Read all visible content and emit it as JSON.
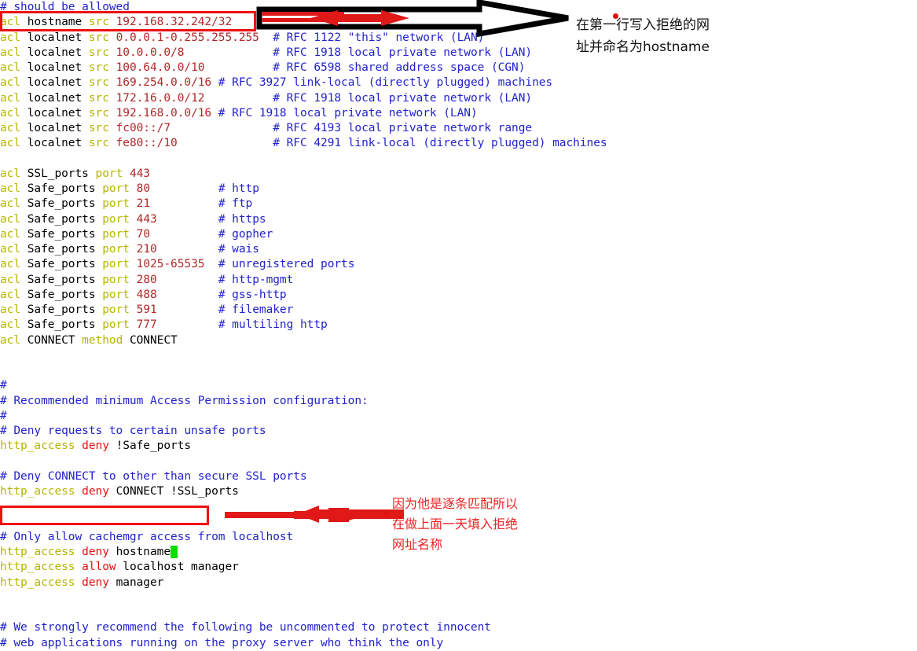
{
  "window": {
    "app": "squid.conf",
    "background": "#ffffff"
  },
  "colors": {
    "keyword": "#b5b500",
    "identifier": "#000000",
    "value": "#b02828",
    "comment": "#2222cc",
    "verb": "#e81010",
    "highlight_box": "#ee1111",
    "caret": "#00e000",
    "annotation_black": "#111111",
    "annotation_red": "#ee2222"
  },
  "code": {
    "lines": [
      {
        "id": "l01",
        "segments": [
          {
            "t": "# should be allowed",
            "c": "cmt"
          }
        ]
      },
      {
        "id": "l02",
        "segments": [
          {
            "t": "acl",
            "c": "kw"
          },
          {
            "t": " hostname ",
            "c": "name"
          },
          {
            "t": "src",
            "c": "kw"
          },
          {
            "t": " 192.168.32.242/32",
            "c": "val"
          }
        ]
      },
      {
        "id": "l03",
        "segments": [
          {
            "t": "acl",
            "c": "kw"
          },
          {
            "t": " localnet ",
            "c": "name"
          },
          {
            "t": "src",
            "c": "kw"
          },
          {
            "t": " 0.0.0.1-0.255.255.255",
            "c": "val"
          },
          {
            "t": "\t",
            "c": "plain"
          },
          {
            "t": "# RFC 1122 \"this\" network (LAN)",
            "c": "cmt"
          }
        ]
      },
      {
        "id": "l04",
        "segments": [
          {
            "t": "acl",
            "c": "kw"
          },
          {
            "t": " localnet ",
            "c": "name"
          },
          {
            "t": "src",
            "c": "kw"
          },
          {
            "t": " 10.0.0.0/8",
            "c": "val"
          },
          {
            "t": "\t\t",
            "c": "plain"
          },
          {
            "t": "# RFC 1918 local private network (LAN)",
            "c": "cmt"
          }
        ]
      },
      {
        "id": "l05",
        "segments": [
          {
            "t": "acl",
            "c": "kw"
          },
          {
            "t": " localnet ",
            "c": "name"
          },
          {
            "t": "src",
            "c": "kw"
          },
          {
            "t": " 100.64.0.0/10",
            "c": "val"
          },
          {
            "t": "\t\t",
            "c": "plain"
          },
          {
            "t": "# RFC 6598 shared address space (CGN)",
            "c": "cmt"
          }
        ]
      },
      {
        "id": "l06",
        "segments": [
          {
            "t": "acl",
            "c": "kw"
          },
          {
            "t": " localnet ",
            "c": "name"
          },
          {
            "t": "src",
            "c": "kw"
          },
          {
            "t": " 169.254.0.0/16",
            "c": "val"
          },
          {
            "t": "\t",
            "c": "plain"
          },
          {
            "t": "# RFC 3927 link-local (directly plugged) machines",
            "c": "cmt"
          }
        ]
      },
      {
        "id": "l07",
        "segments": [
          {
            "t": "acl",
            "c": "kw"
          },
          {
            "t": " localnet ",
            "c": "name"
          },
          {
            "t": "src",
            "c": "kw"
          },
          {
            "t": " 172.16.0.0/12",
            "c": "val"
          },
          {
            "t": "\t\t",
            "c": "plain"
          },
          {
            "t": "# RFC 1918 local private network (LAN)",
            "c": "cmt"
          }
        ]
      },
      {
        "id": "l08",
        "segments": [
          {
            "t": "acl",
            "c": "kw"
          },
          {
            "t": " localnet ",
            "c": "name"
          },
          {
            "t": "src",
            "c": "kw"
          },
          {
            "t": " 192.168.0.0/16",
            "c": "val"
          },
          {
            "t": "\t",
            "c": "plain"
          },
          {
            "t": "# RFC 1918 local private network (LAN)",
            "c": "cmt"
          }
        ]
      },
      {
        "id": "l09",
        "segments": [
          {
            "t": "acl",
            "c": "kw"
          },
          {
            "t": " localnet ",
            "c": "name"
          },
          {
            "t": "src",
            "c": "kw"
          },
          {
            "t": " fc00::/7",
            "c": "val"
          },
          {
            "t": "\t\t",
            "c": "plain"
          },
          {
            "t": "# RFC 4193 local private network range",
            "c": "cmt"
          }
        ]
      },
      {
        "id": "l10",
        "segments": [
          {
            "t": "acl",
            "c": "kw"
          },
          {
            "t": " localnet ",
            "c": "name"
          },
          {
            "t": "src",
            "c": "kw"
          },
          {
            "t": " fe80::/10",
            "c": "val"
          },
          {
            "t": "\t\t",
            "c": "plain"
          },
          {
            "t": "# RFC 4291 link-local (directly plugged) machines",
            "c": "cmt"
          }
        ]
      },
      {
        "id": "l11",
        "segments": []
      },
      {
        "id": "l12",
        "segments": [
          {
            "t": "acl",
            "c": "kw"
          },
          {
            "t": " SSL_ports ",
            "c": "name"
          },
          {
            "t": "port",
            "c": "kw"
          },
          {
            "t": " 443",
            "c": "val"
          }
        ]
      },
      {
        "id": "l13",
        "segments": [
          {
            "t": "acl",
            "c": "kw"
          },
          {
            "t": " Safe_ports ",
            "c": "name"
          },
          {
            "t": "port",
            "c": "kw"
          },
          {
            "t": " 80",
            "c": "val"
          },
          {
            "t": "\t\t",
            "c": "plain"
          },
          {
            "t": "# http",
            "c": "cmt"
          }
        ]
      },
      {
        "id": "l14",
        "segments": [
          {
            "t": "acl",
            "c": "kw"
          },
          {
            "t": " Safe_ports ",
            "c": "name"
          },
          {
            "t": "port",
            "c": "kw"
          },
          {
            "t": " 21",
            "c": "val"
          },
          {
            "t": "\t\t",
            "c": "plain"
          },
          {
            "t": "# ftp",
            "c": "cmt"
          }
        ]
      },
      {
        "id": "l15",
        "segments": [
          {
            "t": "acl",
            "c": "kw"
          },
          {
            "t": " Safe_ports ",
            "c": "name"
          },
          {
            "t": "port",
            "c": "kw"
          },
          {
            "t": " 443",
            "c": "val"
          },
          {
            "t": "\t\t",
            "c": "plain"
          },
          {
            "t": "# https",
            "c": "cmt"
          }
        ]
      },
      {
        "id": "l16",
        "segments": [
          {
            "t": "acl",
            "c": "kw"
          },
          {
            "t": " Safe_ports ",
            "c": "name"
          },
          {
            "t": "port",
            "c": "kw"
          },
          {
            "t": " 70",
            "c": "val"
          },
          {
            "t": "\t\t",
            "c": "plain"
          },
          {
            "t": "# gopher",
            "c": "cmt"
          }
        ]
      },
      {
        "id": "l17",
        "segments": [
          {
            "t": "acl",
            "c": "kw"
          },
          {
            "t": " Safe_ports ",
            "c": "name"
          },
          {
            "t": "port",
            "c": "kw"
          },
          {
            "t": " 210",
            "c": "val"
          },
          {
            "t": "\t\t",
            "c": "plain"
          },
          {
            "t": "# wais",
            "c": "cmt"
          }
        ]
      },
      {
        "id": "l18",
        "segments": [
          {
            "t": "acl",
            "c": "kw"
          },
          {
            "t": " Safe_ports ",
            "c": "name"
          },
          {
            "t": "port",
            "c": "kw"
          },
          {
            "t": " 1025-65535",
            "c": "val"
          },
          {
            "t": "\t",
            "c": "plain"
          },
          {
            "t": "# unregistered ports",
            "c": "cmt"
          }
        ]
      },
      {
        "id": "l19",
        "segments": [
          {
            "t": "acl",
            "c": "kw"
          },
          {
            "t": " Safe_ports ",
            "c": "name"
          },
          {
            "t": "port",
            "c": "kw"
          },
          {
            "t": " 280",
            "c": "val"
          },
          {
            "t": "\t\t",
            "c": "plain"
          },
          {
            "t": "# http-mgmt",
            "c": "cmt"
          }
        ]
      },
      {
        "id": "l20",
        "segments": [
          {
            "t": "acl",
            "c": "kw"
          },
          {
            "t": " Safe_ports ",
            "c": "name"
          },
          {
            "t": "port",
            "c": "kw"
          },
          {
            "t": " 488",
            "c": "val"
          },
          {
            "t": "\t\t",
            "c": "plain"
          },
          {
            "t": "# gss-http",
            "c": "cmt"
          }
        ]
      },
      {
        "id": "l21",
        "segments": [
          {
            "t": "acl",
            "c": "kw"
          },
          {
            "t": " Safe_ports ",
            "c": "name"
          },
          {
            "t": "port",
            "c": "kw"
          },
          {
            "t": " 591",
            "c": "val"
          },
          {
            "t": "\t\t",
            "c": "plain"
          },
          {
            "t": "# filemaker",
            "c": "cmt"
          }
        ]
      },
      {
        "id": "l22",
        "segments": [
          {
            "t": "acl",
            "c": "kw"
          },
          {
            "t": " Safe_ports ",
            "c": "name"
          },
          {
            "t": "port",
            "c": "kw"
          },
          {
            "t": " 777",
            "c": "val"
          },
          {
            "t": "\t\t",
            "c": "plain"
          },
          {
            "t": "# multiling http",
            "c": "cmt"
          }
        ]
      },
      {
        "id": "l23",
        "segments": [
          {
            "t": "acl",
            "c": "kw"
          },
          {
            "t": " CONNECT ",
            "c": "name"
          },
          {
            "t": "method",
            "c": "kw"
          },
          {
            "t": " CONNECT",
            "c": "name"
          }
        ]
      },
      {
        "id": "l24",
        "segments": []
      },
      {
        "id": "l25",
        "segments": []
      },
      {
        "id": "l26",
        "segments": [
          {
            "t": "#",
            "c": "cmt"
          }
        ]
      },
      {
        "id": "l27",
        "segments": [
          {
            "t": "# Recommended minimum Access Permission configuration:",
            "c": "cmt"
          }
        ]
      },
      {
        "id": "l28",
        "segments": [
          {
            "t": "#",
            "c": "cmt"
          }
        ]
      },
      {
        "id": "l29",
        "segments": [
          {
            "t": "# Deny requests to certain unsafe ports",
            "c": "cmt"
          }
        ]
      },
      {
        "id": "l30",
        "segments": [
          {
            "t": "http_access",
            "c": "kw"
          },
          {
            "t": " ",
            "c": "plain"
          },
          {
            "t": "deny",
            "c": "deny"
          },
          {
            "t": " !Safe_ports",
            "c": "name"
          }
        ]
      },
      {
        "id": "l31",
        "segments": []
      },
      {
        "id": "l32",
        "segments": [
          {
            "t": "# Deny CONNECT to other than secure SSL ports",
            "c": "cmt"
          }
        ]
      },
      {
        "id": "l33",
        "segments": [
          {
            "t": "http_access",
            "c": "kw"
          },
          {
            "t": " ",
            "c": "plain"
          },
          {
            "t": "deny",
            "c": "deny"
          },
          {
            "t": " CONNECT !SSL_ports",
            "c": "name"
          }
        ]
      },
      {
        "id": "l34",
        "segments": []
      },
      {
        "id": "l35",
        "segments": []
      },
      {
        "id": "l36",
        "segments": [
          {
            "t": "# Only allow cachemgr access from localhost",
            "c": "cmt"
          }
        ]
      },
      {
        "id": "l37",
        "segments": [
          {
            "t": "http_access",
            "c": "kw"
          },
          {
            "t": " ",
            "c": "plain"
          },
          {
            "t": "deny",
            "c": "deny"
          },
          {
            "t": " hostname",
            "c": "name"
          },
          {
            "t": " ",
            "c": "caret"
          }
        ]
      },
      {
        "id": "l38",
        "segments": [
          {
            "t": "http_access",
            "c": "kw"
          },
          {
            "t": " ",
            "c": "plain"
          },
          {
            "t": "allow",
            "c": "deny"
          },
          {
            "t": " localhost manager",
            "c": "name"
          }
        ]
      },
      {
        "id": "l39",
        "segments": [
          {
            "t": "http_access",
            "c": "kw"
          },
          {
            "t": " ",
            "c": "plain"
          },
          {
            "t": "deny",
            "c": "deny"
          },
          {
            "t": " manager",
            "c": "name"
          }
        ]
      },
      {
        "id": "l40",
        "segments": []
      },
      {
        "id": "l41",
        "segments": []
      },
      {
        "id": "l42",
        "segments": [
          {
            "t": "# We strongly recommend the following be uncommented to protect innocent",
            "c": "cmt"
          }
        ]
      },
      {
        "id": "l43",
        "segments": [
          {
            "t": "# web applications running on the proxy server who think the only",
            "c": "cmt"
          }
        ]
      }
    ]
  },
  "annotations": {
    "top_note": "在第一行写入拒绝的网\n址并命名为hostname",
    "bottom_note": "因为他是逐条匹配所以\n在做上面一天填入拒绝\n网址名称",
    "top_highlight_target": "acl hostname src 192.168.32.242/32",
    "bottom_highlight_target": "http_access deny hostname"
  }
}
